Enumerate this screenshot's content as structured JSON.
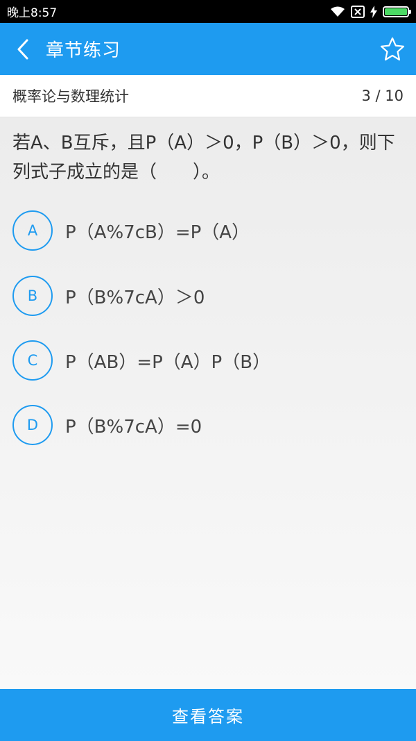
{
  "status_bar": {
    "time": "晚上8:57",
    "icons": [
      "wifi-icon",
      "no-sim-icon",
      "charging-icon",
      "battery-icon"
    ]
  },
  "app_bar": {
    "title": "章节练习",
    "back_icon": "chevron-left-icon",
    "star_icon": "star-outline-icon"
  },
  "chapter": {
    "name": "概率论与数理统计",
    "progress": "3 / 10"
  },
  "question": {
    "text": "若A、B互斥，且P（A）＞0，P（B）＞0，则下列式子成立的是（　　）。",
    "options": [
      {
        "key": "A",
        "text": "P（A%7cB）=P（A）"
      },
      {
        "key": "B",
        "text": "P（B%7cA）＞0"
      },
      {
        "key": "C",
        "text": "P（AB）=P（A）P（B）"
      },
      {
        "key": "D",
        "text": "P（B%7cA）=0"
      }
    ]
  },
  "footer": {
    "button_label": "查看答案"
  },
  "colors": {
    "accent": "#1e9bf0",
    "status_bar": "#000000",
    "battery_fill": "#4cd964"
  }
}
